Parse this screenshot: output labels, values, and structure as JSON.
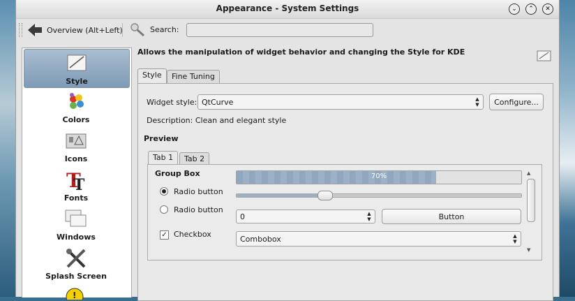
{
  "window": {
    "title": "Appearance - System Settings"
  },
  "toolbar": {
    "back_label": "Overview (Alt+Left)",
    "search_label": "Search:",
    "search_value": ""
  },
  "sidebar": {
    "items": [
      {
        "label": "Style",
        "icon": "style-icon",
        "selected": true
      },
      {
        "label": "Colors",
        "icon": "colors-icon"
      },
      {
        "label": "Icons",
        "icon": "icons-icon"
      },
      {
        "label": "Fonts",
        "icon": "fonts-icon"
      },
      {
        "label": "Windows",
        "icon": "windows-icon"
      },
      {
        "label": "Splash Screen",
        "icon": "splash-screen-icon"
      }
    ]
  },
  "main": {
    "heading": "Allows the manipulation of widget behavior and changing the Style for KDE",
    "tabs": [
      {
        "label": "Style",
        "active": true
      },
      {
        "label": "Fine Tuning"
      }
    ],
    "widget_style_label": "Widget style:",
    "widget_style_value": "QtCurve",
    "configure_label": "Configure...",
    "description": "Description: Clean and elegant style",
    "preview_label": "Preview",
    "preview": {
      "tabs": [
        {
          "label": "Tab 1",
          "active": true
        },
        {
          "label": "Tab 2"
        }
      ],
      "group_box_label": "Group Box",
      "progress_percent": 70,
      "progress_text": "70%",
      "slider_value": 0.3,
      "radio1_label": "Radio button",
      "radio2_label": "Radio button",
      "checkbox_label": "Checkbox",
      "checkbox_checked": true,
      "spin_value": "0",
      "button_label": "Button",
      "combobox_value": "Combobox"
    }
  },
  "colors": {
    "selection": "#8ea8c0",
    "progress": "#90a8bf"
  }
}
